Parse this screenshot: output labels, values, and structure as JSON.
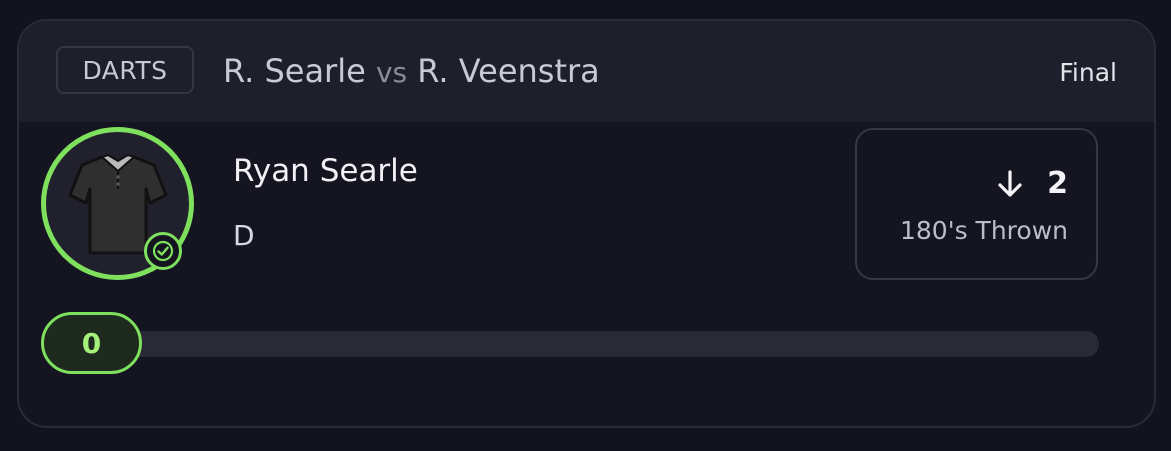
{
  "header": {
    "sport_badge": "DARTS",
    "player1_short": "R. Searle",
    "vs_text": "vs",
    "player2_short": "R. Veenstra",
    "status": "Final"
  },
  "player": {
    "name": "Ryan Searle",
    "position": "D",
    "avatar_icon": "jersey-icon",
    "verified_icon": "check-circle-icon"
  },
  "stat": {
    "direction": "down",
    "direction_icon": "arrow-down-icon",
    "line_value": "2",
    "label": "180's Thrown"
  },
  "progress": {
    "current_value": "0"
  },
  "colors": {
    "accent": "#7fe05d",
    "background": "#13131f",
    "card": "#151521",
    "header": "#1f1f2b"
  }
}
